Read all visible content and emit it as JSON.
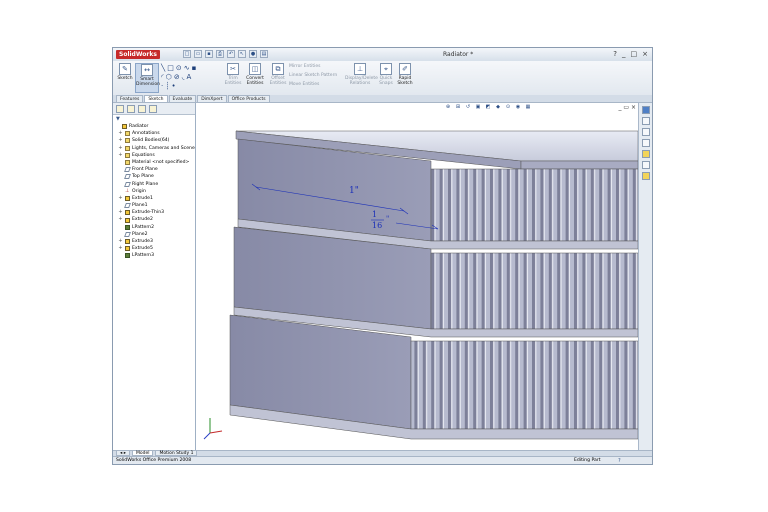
{
  "app": {
    "logo": "SolidWorks",
    "doc_title": "Radiator *",
    "window_controls": [
      "?",
      "_",
      "□",
      "×"
    ]
  },
  "quick_access": [
    "new-icon",
    "open-icon",
    "save-icon",
    "print-icon",
    "undo-icon",
    "select-icon",
    "rebuild-icon",
    "options-icon"
  ],
  "ribbon": {
    "sketch": "Sketch",
    "smart_dimension": "Smart Dimension",
    "trim_entities": "Trim Entities",
    "convert_entities": "Convert Entities",
    "offset_entities": "Offset Entities",
    "mirror_entities": "Mirror Entities",
    "linear_pattern": "Linear Sketch Pattern",
    "move_entities": "Move Entities",
    "display_relations": "Display/Delete Relations",
    "quick_snaps": "Quick Snaps",
    "rapid_sketch": "Rapid Sketch"
  },
  "tabs": [
    "Features",
    "Sketch",
    "Evaluate",
    "DimXpert",
    "Office Products"
  ],
  "active_tab": "Sketch",
  "tree": {
    "root": "Radiator",
    "items": [
      {
        "label": "Annotations",
        "pm": "+",
        "icon": "annotations"
      },
      {
        "label": "Solid Bodies(64)",
        "pm": "+",
        "icon": "solid-bodies"
      },
      {
        "label": "Lights, Cameras and Scene",
        "pm": "+",
        "icon": "lights"
      },
      {
        "label": "Equations",
        "pm": "+",
        "icon": "equations"
      },
      {
        "label": "Material <not specified>",
        "pm": "",
        "icon": "material"
      },
      {
        "label": "Front Plane",
        "pm": "",
        "icon": "plane"
      },
      {
        "label": "Top Plane",
        "pm": "",
        "icon": "plane"
      },
      {
        "label": "Right Plane",
        "pm": "",
        "icon": "plane"
      },
      {
        "label": "Origin",
        "pm": "",
        "icon": "origin"
      },
      {
        "label": "Extrude1",
        "pm": "+",
        "icon": "feature"
      },
      {
        "label": "Plane1",
        "pm": "",
        "icon": "plane"
      },
      {
        "label": "Extrude-Thin3",
        "pm": "+",
        "icon": "feature"
      },
      {
        "label": "Extrude2",
        "pm": "+",
        "icon": "feature"
      },
      {
        "label": "LPattern2",
        "pm": "",
        "icon": "pattern"
      },
      {
        "label": "Plane2",
        "pm": "",
        "icon": "plane"
      },
      {
        "label": "Extrude3",
        "pm": "+",
        "icon": "feature"
      },
      {
        "label": "Extrude5",
        "pm": "+",
        "icon": "feature"
      },
      {
        "label": "LPattern3",
        "pm": "",
        "icon": "pattern"
      }
    ]
  },
  "viewport": {
    "dimension_1": "1\"",
    "dimension_2_num": "1",
    "dimension_2_den": "16",
    "dimension_2_unit": "\""
  },
  "bottom_tabs": [
    "Model",
    "Motion Study 1"
  ],
  "status": {
    "left": "SolidWorks Office Premium 2008",
    "right": "Editing Part",
    "help": "?"
  }
}
